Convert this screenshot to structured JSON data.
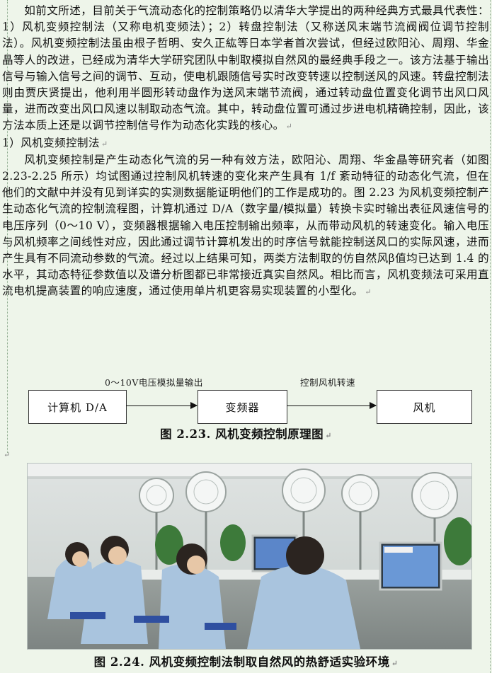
{
  "body": {
    "para1": "如前文所述，目前关于气流动态化的控制策略仍以清华大学提出的两种经典方式最具代表性：1）风机变频控制法（又称电机变频法）；2）转盘控制法（又称送风末端节流阀阀位调节控制法）。风机变频控制法虽由根子哲明、安久正紘等日本学者首次尝试，但经过欧阳沁、周翔、华金晶等人的改进，已经成为清华大学研究团队中制取模拟自然风的最经典手段之一。该方法基于输出信号与输入信号之间的调节、互动，使电机跟随信号实时改变转速以控制送风的风速。转盘控制法则由贾庆贤提出，他利用半圆形转动盘作为送风末端节流阀，通过转动盘位置变化调节出风口风量，进而改变出风口风速以制取动态气流。其中，转动盘位置可通过步进电机精确控制，因此，该方法本质上还是以调节控制信号作为动态化实践的核心。",
    "heading": "1）风机变频控制法",
    "para2": "风机变频控制是产生动态化气流的另一种有效方法，欧阳沁、周翔、华金晶等研究者（如图 2.23-2.25 所示）均试图通过控制风机转速的变化来产生具有 1/f 紊动特征的动态化气流，但在他们的文献中并没有见到详实的实测数据能证明他们的工作是成功的。图 2.23 为风机变频控制产生动态化气流的控制流程图，计算机通过 D/A（数字量/模拟量）转换卡实时输出表征风速信号的电压序列（0～10 V），变频器根据输入电压控制输出频率，从而带动风机的转速变化。输入电压与风机频率之间线性对应，因此通过调节计算机发出的时序信号就能控制送风口的实际风速，进而产生具有不同流动参数的气流。经过以上结果可知，两类方法制取的仿自然风β值均已达到 1.4 的水平，其动态特征参数值以及谱分析图都已非常接近真实自然风。相比而言，风机变频法可采用直流电机提高装置的响应速度，通过使用单片机更容易实现装置的小型化。"
  },
  "figure_223": {
    "label_left": "0～10V电压模拟量输出",
    "label_right": "控制风机转速",
    "boxes": [
      "计算机 D/A",
      "变频器",
      "风机"
    ],
    "caption": "图 2.23.  风机变频控制原理图"
  },
  "figure_224": {
    "caption": "图 2.24.  风机变频控制法制取自然风的热舒适实验环境"
  },
  "marks": {
    "para": "↵"
  }
}
